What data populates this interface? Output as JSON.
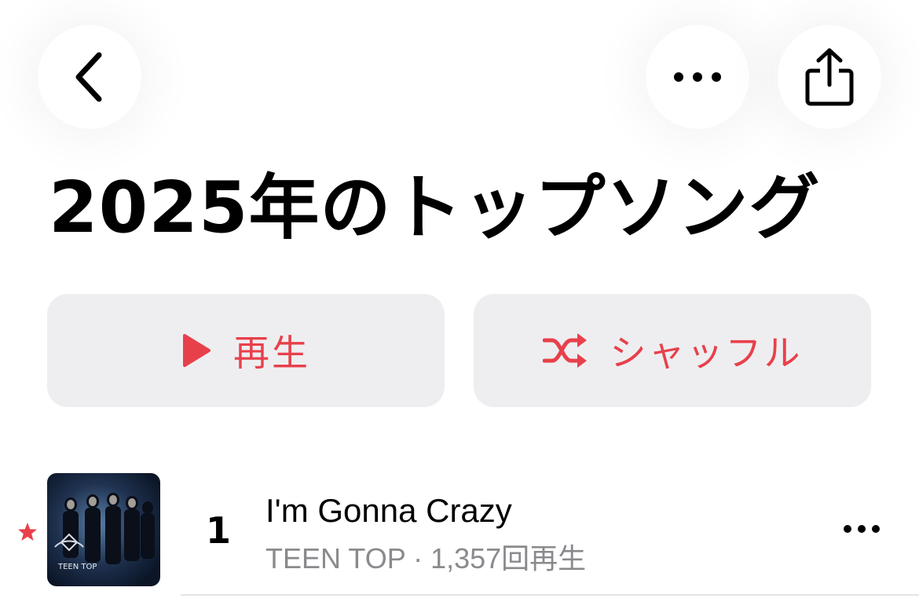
{
  "header": {
    "back_icon": "chevron-left-icon",
    "more_icon": "ellipsis-icon",
    "share_icon": "share-icon"
  },
  "page": {
    "title": "2025年のトップソング"
  },
  "actions": {
    "play_label": "再生",
    "shuffle_label": "シャッフル",
    "accent_color": "#e8404b"
  },
  "tracks": [
    {
      "rank": "1",
      "title": "I'm Gonna Crazy",
      "artist": "TEEN TOP",
      "separator": " · ",
      "plays": "1,357回再生",
      "favorite": true,
      "artwork_text": "TEEN TOP"
    }
  ]
}
